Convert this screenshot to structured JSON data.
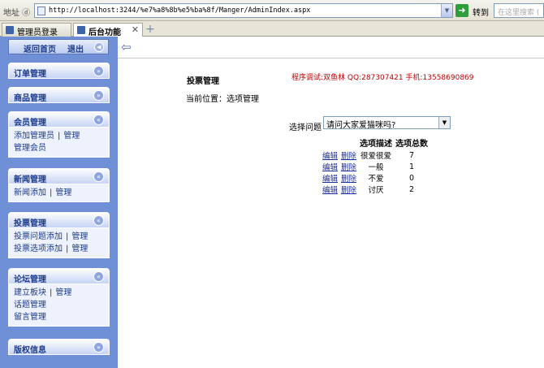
{
  "browser": {
    "address_label": "地址 ⓓ",
    "url": "http://localhost:3244/%e7%a8%8b%e5%ba%8f/Manger/AdminIndex.aspx",
    "go_label": "转到",
    "search_placeholder": "在这里搜索 (",
    "tabs": [
      {
        "label": "管理员登录",
        "active": false
      },
      {
        "label": "后台功能",
        "active": true
      }
    ]
  },
  "sidebar": {
    "home_link": "返回首页",
    "logout_link": "退出",
    "groups": {
      "orders": {
        "title": "订单管理"
      },
      "products": {
        "title": "商品管理"
      },
      "members": {
        "title": "会员管理",
        "add_admin": "添加管理员",
        "manage": "管理",
        "member_manage": "管理会员"
      },
      "news": {
        "title": "新闻管理",
        "add": "新闻添加",
        "manage": "管理"
      },
      "votes": {
        "title": "投票管理",
        "add_question": "投票问题添加",
        "manage_q": "管理",
        "add_option": "投票选项添加",
        "manage_o": "管理"
      },
      "forum": {
        "title": "论坛管理",
        "add_board": "建立板块",
        "manage": "管理",
        "topics": "话题管理",
        "messages": "留言管理"
      },
      "copyright": {
        "title": "版权信息"
      }
    }
  },
  "main": {
    "title": "投票管理",
    "contact": "程序调试:双鱼林 QQ:287307421 手机:13558690869",
    "location": "当前位置：选项管理",
    "question_label": "选择问题",
    "question_value": "请问大家爱猫咪吗?",
    "table": {
      "headers": [
        "",
        "",
        "选项描述",
        "选项总数"
      ],
      "rows": [
        {
          "edit": "编辑",
          "del": "删除",
          "desc": "很爱很爱",
          "count": "7"
        },
        {
          "edit": "编辑",
          "del": "删除",
          "desc": "一般",
          "count": "1"
        },
        {
          "edit": "编辑",
          "del": "删除",
          "desc": "不爱",
          "count": "0"
        },
        {
          "edit": "编辑",
          "del": "删除",
          "desc": "讨厌",
          "count": "2"
        }
      ]
    }
  },
  "colors": {
    "sidebar_bg": "#6f8fd6",
    "contact_text": "#c00000",
    "link": "#1b2f9e"
  }
}
